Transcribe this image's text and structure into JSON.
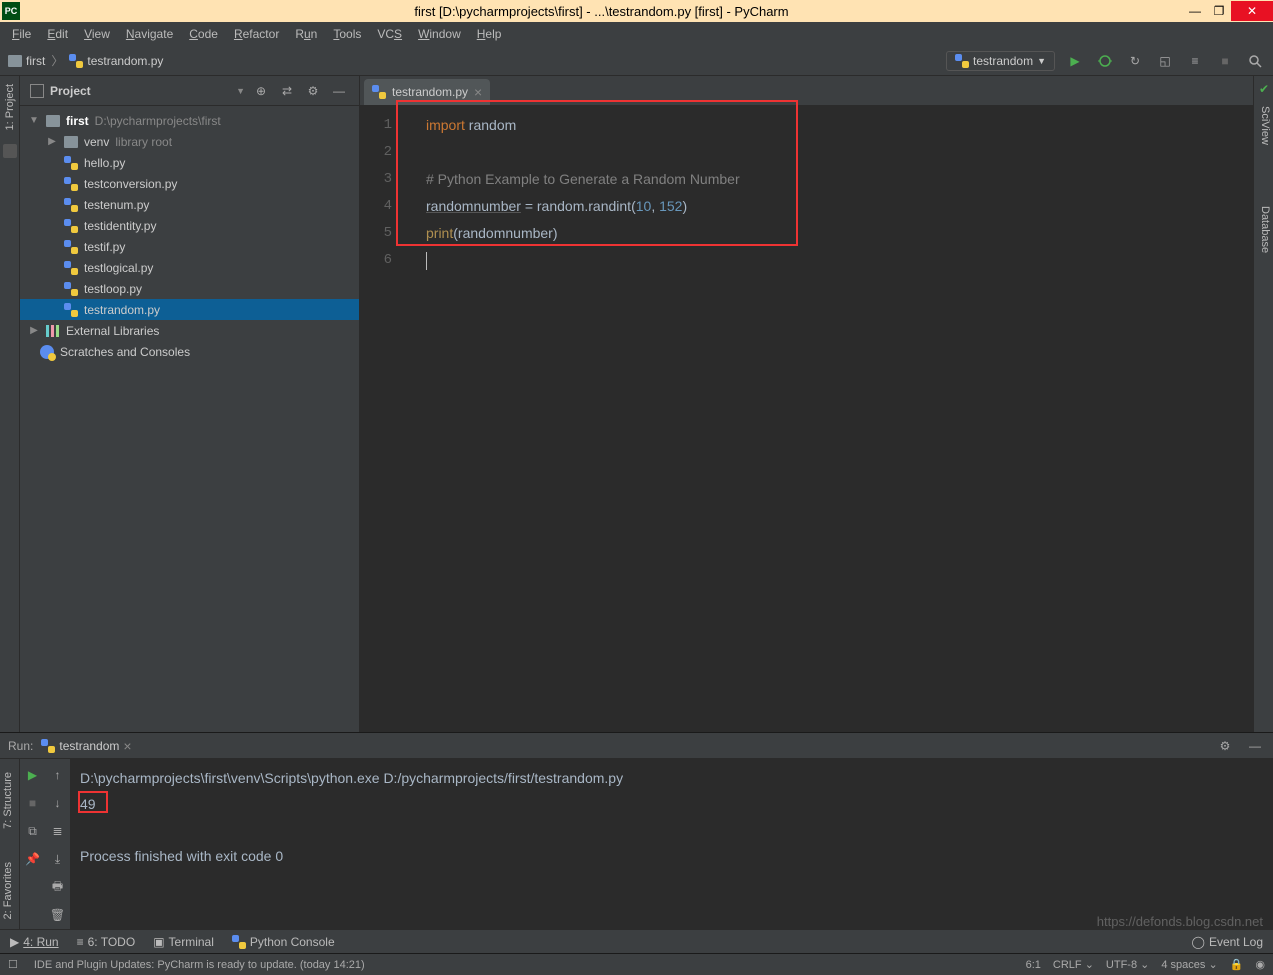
{
  "window": {
    "title": "first [D:\\pycharmprojects\\first] - ...\\testrandom.py [first] - PyCharm",
    "app_icon": "PC"
  },
  "menu": {
    "items": [
      "File",
      "Edit",
      "View",
      "Navigate",
      "Code",
      "Refactor",
      "Run",
      "Tools",
      "VCS",
      "Window",
      "Help"
    ]
  },
  "breadcrumbs": {
    "root": "first",
    "file": "testrandom.py"
  },
  "run_config": {
    "label": "testrandom"
  },
  "toolbar_icons": [
    "run",
    "debug",
    "coverage",
    "profile",
    "attach",
    "stop",
    "search"
  ],
  "sidebar": {
    "title": "Project",
    "root": {
      "name": "first",
      "path": "D:\\pycharmprojects\\first"
    },
    "venv": "venv",
    "venv_suffix": "library root",
    "files": [
      "hello.py",
      "testconversion.py",
      "testenum.py",
      "testidentity.py",
      "testif.py",
      "testlogical.py",
      "testloop.py",
      "testrandom.py"
    ],
    "external": "External Libraries",
    "scratches": "Scratches and Consoles",
    "selected": "testrandom.py"
  },
  "left_tabs": {
    "t1": "1: Project"
  },
  "right_tabs": {
    "t1": "SciView",
    "t2": "Database"
  },
  "left_tabs2": {
    "t1": "7: Structure",
    "t2": "2: Favorites"
  },
  "editor": {
    "tab_name": "testrandom.py",
    "line_count": 6,
    "code": {
      "l1_kw": "import",
      "l1_id": "random",
      "l3_cmt": "# Python Example to Generate a Random Number",
      "l4_var": "randomnumber",
      "l4_eq": " = random.",
      "l4_fn": "randint",
      "l4_p": "(",
      "l4_n1": "10",
      "l4_c": ", ",
      "l4_n2": "152",
      "l4_cp": ")",
      "l5_fn": "print",
      "l5_p": "(",
      "l5_arg": "randomnumber",
      "l5_cp": ")"
    }
  },
  "run": {
    "label": "Run:",
    "tab": "testrandom",
    "output_cmd": "D:\\pycharmprojects\\first\\venv\\Scripts\\python.exe D:/pycharmprojects/first/testrandom.py",
    "output_val": "49",
    "output_exit": "Process finished with exit code 0"
  },
  "bottom": {
    "run": "4: Run",
    "todo": "6: TODO",
    "terminal": "Terminal",
    "pyconsole": "Python Console",
    "eventlog": "Event Log"
  },
  "status": {
    "msg": "IDE and Plugin Updates: PyCharm is ready to update. (today 14:21)",
    "pos": "6:1",
    "eol": "CRLF",
    "enc": "UTF-8",
    "indent": "4 spaces"
  },
  "watermark": "https://defonds.blog.csdn.net"
}
